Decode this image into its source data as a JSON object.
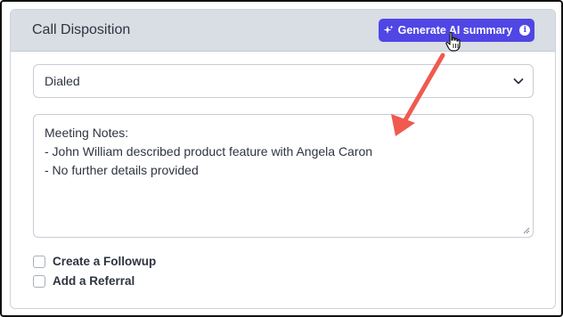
{
  "card": {
    "title": "Call Disposition",
    "ai_button_label": "Generate AI summary",
    "info_symbol": "i"
  },
  "disposition": {
    "selected": "Dialed"
  },
  "notes": {
    "lines": [
      "Meeting Notes:",
      "- John William described product feature with Angela Caron",
      "- No further details provided"
    ]
  },
  "options": {
    "followup_label": "Create a Followup",
    "referral_label": "Add a Referral"
  },
  "colors": {
    "accent": "#4f46e5",
    "arrow": "#f05a4f",
    "header_bg": "#d9dde4"
  },
  "icons": {
    "ai_button": "sparkle-icon",
    "info": "info-icon",
    "select": "chevron-down-icon",
    "cursor": "hand-pointer-icon"
  }
}
